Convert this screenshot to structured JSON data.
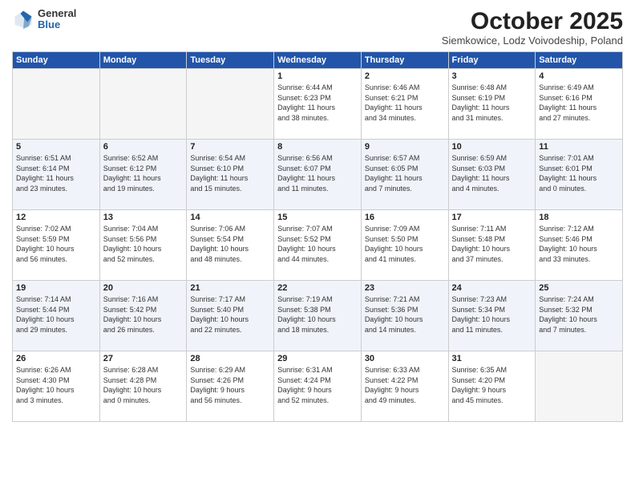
{
  "logo": {
    "general": "General",
    "blue": "Blue"
  },
  "title": {
    "month": "October 2025",
    "location": "Siemkowice, Lodz Voivodeship, Poland"
  },
  "weekdays": [
    "Sunday",
    "Monday",
    "Tuesday",
    "Wednesday",
    "Thursday",
    "Friday",
    "Saturday"
  ],
  "weeks": [
    [
      {
        "day": "",
        "info": ""
      },
      {
        "day": "",
        "info": ""
      },
      {
        "day": "",
        "info": ""
      },
      {
        "day": "1",
        "info": "Sunrise: 6:44 AM\nSunset: 6:23 PM\nDaylight: 11 hours\nand 38 minutes."
      },
      {
        "day": "2",
        "info": "Sunrise: 6:46 AM\nSunset: 6:21 PM\nDaylight: 11 hours\nand 34 minutes."
      },
      {
        "day": "3",
        "info": "Sunrise: 6:48 AM\nSunset: 6:19 PM\nDaylight: 11 hours\nand 31 minutes."
      },
      {
        "day": "4",
        "info": "Sunrise: 6:49 AM\nSunset: 6:16 PM\nDaylight: 11 hours\nand 27 minutes."
      }
    ],
    [
      {
        "day": "5",
        "info": "Sunrise: 6:51 AM\nSunset: 6:14 PM\nDaylight: 11 hours\nand 23 minutes."
      },
      {
        "day": "6",
        "info": "Sunrise: 6:52 AM\nSunset: 6:12 PM\nDaylight: 11 hours\nand 19 minutes."
      },
      {
        "day": "7",
        "info": "Sunrise: 6:54 AM\nSunset: 6:10 PM\nDaylight: 11 hours\nand 15 minutes."
      },
      {
        "day": "8",
        "info": "Sunrise: 6:56 AM\nSunset: 6:07 PM\nDaylight: 11 hours\nand 11 minutes."
      },
      {
        "day": "9",
        "info": "Sunrise: 6:57 AM\nSunset: 6:05 PM\nDaylight: 11 hours\nand 7 minutes."
      },
      {
        "day": "10",
        "info": "Sunrise: 6:59 AM\nSunset: 6:03 PM\nDaylight: 11 hours\nand 4 minutes."
      },
      {
        "day": "11",
        "info": "Sunrise: 7:01 AM\nSunset: 6:01 PM\nDaylight: 11 hours\nand 0 minutes."
      }
    ],
    [
      {
        "day": "12",
        "info": "Sunrise: 7:02 AM\nSunset: 5:59 PM\nDaylight: 10 hours\nand 56 minutes."
      },
      {
        "day": "13",
        "info": "Sunrise: 7:04 AM\nSunset: 5:56 PM\nDaylight: 10 hours\nand 52 minutes."
      },
      {
        "day": "14",
        "info": "Sunrise: 7:06 AM\nSunset: 5:54 PM\nDaylight: 10 hours\nand 48 minutes."
      },
      {
        "day": "15",
        "info": "Sunrise: 7:07 AM\nSunset: 5:52 PM\nDaylight: 10 hours\nand 44 minutes."
      },
      {
        "day": "16",
        "info": "Sunrise: 7:09 AM\nSunset: 5:50 PM\nDaylight: 10 hours\nand 41 minutes."
      },
      {
        "day": "17",
        "info": "Sunrise: 7:11 AM\nSunset: 5:48 PM\nDaylight: 10 hours\nand 37 minutes."
      },
      {
        "day": "18",
        "info": "Sunrise: 7:12 AM\nSunset: 5:46 PM\nDaylight: 10 hours\nand 33 minutes."
      }
    ],
    [
      {
        "day": "19",
        "info": "Sunrise: 7:14 AM\nSunset: 5:44 PM\nDaylight: 10 hours\nand 29 minutes."
      },
      {
        "day": "20",
        "info": "Sunrise: 7:16 AM\nSunset: 5:42 PM\nDaylight: 10 hours\nand 26 minutes."
      },
      {
        "day": "21",
        "info": "Sunrise: 7:17 AM\nSunset: 5:40 PM\nDaylight: 10 hours\nand 22 minutes."
      },
      {
        "day": "22",
        "info": "Sunrise: 7:19 AM\nSunset: 5:38 PM\nDaylight: 10 hours\nand 18 minutes."
      },
      {
        "day": "23",
        "info": "Sunrise: 7:21 AM\nSunset: 5:36 PM\nDaylight: 10 hours\nand 14 minutes."
      },
      {
        "day": "24",
        "info": "Sunrise: 7:23 AM\nSunset: 5:34 PM\nDaylight: 10 hours\nand 11 minutes."
      },
      {
        "day": "25",
        "info": "Sunrise: 7:24 AM\nSunset: 5:32 PM\nDaylight: 10 hours\nand 7 minutes."
      }
    ],
    [
      {
        "day": "26",
        "info": "Sunrise: 6:26 AM\nSunset: 4:30 PM\nDaylight: 10 hours\nand 3 minutes."
      },
      {
        "day": "27",
        "info": "Sunrise: 6:28 AM\nSunset: 4:28 PM\nDaylight: 10 hours\nand 0 minutes."
      },
      {
        "day": "28",
        "info": "Sunrise: 6:29 AM\nSunset: 4:26 PM\nDaylight: 9 hours\nand 56 minutes."
      },
      {
        "day": "29",
        "info": "Sunrise: 6:31 AM\nSunset: 4:24 PM\nDaylight: 9 hours\nand 52 minutes."
      },
      {
        "day": "30",
        "info": "Sunrise: 6:33 AM\nSunset: 4:22 PM\nDaylight: 9 hours\nand 49 minutes."
      },
      {
        "day": "31",
        "info": "Sunrise: 6:35 AM\nSunset: 4:20 PM\nDaylight: 9 hours\nand 45 minutes."
      },
      {
        "day": "",
        "info": ""
      }
    ]
  ]
}
